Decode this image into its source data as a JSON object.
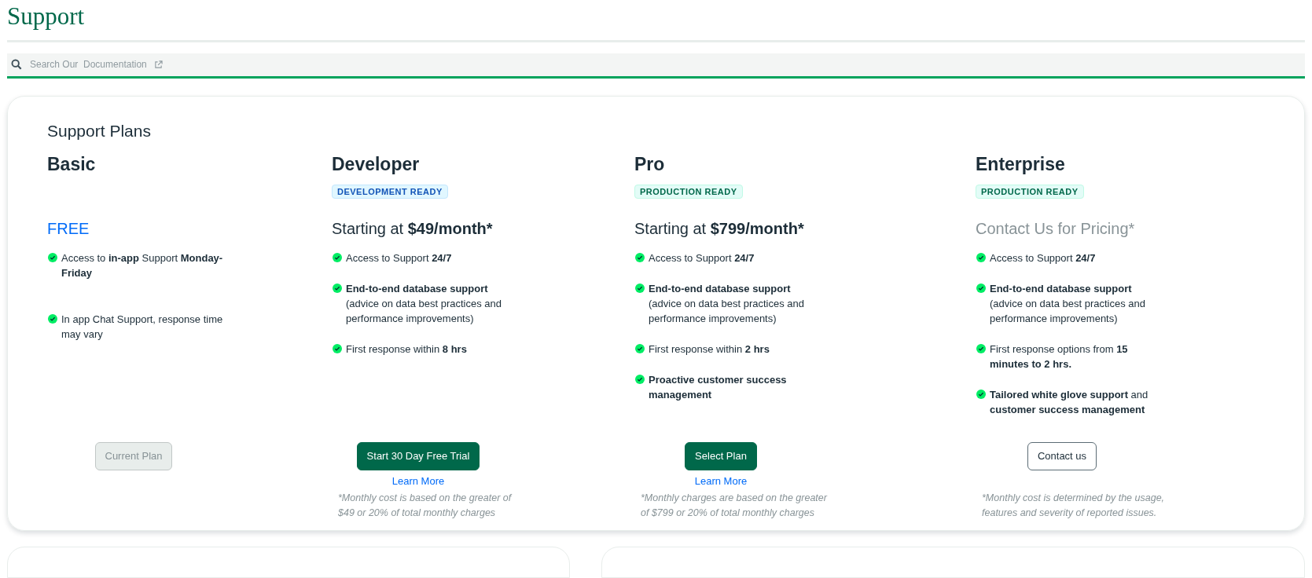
{
  "page_title": "Support",
  "search": {
    "placeholder": "Search Our  Documentation"
  },
  "plans_card": {
    "title": "Support Plans",
    "plans": [
      {
        "name": "Basic",
        "price": {
          "kind": "free",
          "amount": "FREE"
        },
        "features": [
          "Access to **in-app** Support **Monday-Friday**",
          "In app Chat Support, response time may vary"
        ],
        "button": {
          "kind": "disabled",
          "label": "Current Plan"
        }
      },
      {
        "name": "Developer",
        "badge": {
          "text": "DEVELOPMENT READY",
          "color": "#1254b7"
        },
        "price": {
          "kind": "amount",
          "prefix": "Starting at",
          "amount": "$49/month*"
        },
        "features": [
          "Access to Support **24/7**",
          "**End-to-end database support** (advice on data best practices and performance improvements)",
          "First response within **8 hrs**"
        ],
        "button": {
          "kind": "primary",
          "label": "Start 30 Day Free Trial"
        },
        "link": "Learn More",
        "footnote": "*Monthly cost is based on the greater of $49 or 20% of total monthly charges"
      },
      {
        "name": "Pro",
        "badge": {
          "text": "PRODUCTION READY",
          "color": "#00684a"
        },
        "price": {
          "kind": "amount",
          "prefix": "Starting at",
          "amount": "$799/month*"
        },
        "features": [
          "Access to Support **24/7**",
          "**End-to-end database support** (advice on data best practices and performance improvements)",
          "First response within **2 hrs**",
          "**Proactive customer success management**"
        ],
        "button": {
          "kind": "primary",
          "label": "Select Plan"
        },
        "link": "Learn More",
        "footnote": "*Monthly charges are based on the greater of $799 or 20% of total monthly charges"
      },
      {
        "name": "Enterprise",
        "badge": {
          "text": "PRODUCTION READY",
          "color": "#00684a"
        },
        "price": {
          "kind": "contact",
          "amount": "Contact Us for Pricing*"
        },
        "features": [
          "Access to Support **24/7**",
          "**End-to-end database support** (advice on data best practices and performance improvements)",
          "First response options from **15 minutes to 2 hrs.**",
          "**Tailored white glove support** and **customer success management**"
        ],
        "button": {
          "kind": "outline",
          "label": "Contact us"
        },
        "footnote": "*Monthly cost is determined by the usage, features and severity of reported issues."
      }
    ]
  }
}
